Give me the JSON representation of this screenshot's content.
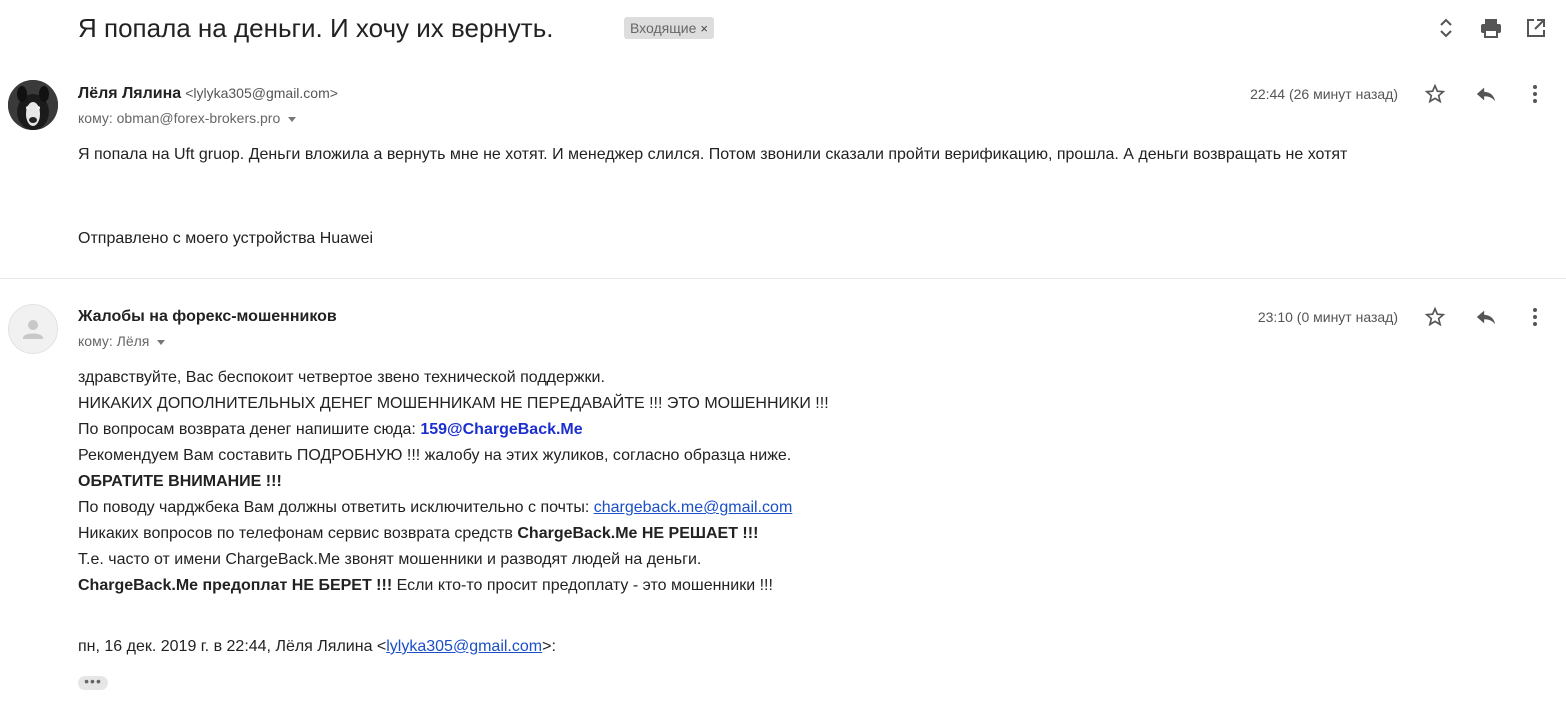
{
  "thread": {
    "subject": "Я попала на деньги. И хочу их вернуть.",
    "label": "Входящие",
    "label_remove": "×"
  },
  "icons": {
    "expand": "unfold-icon",
    "print": "print-icon",
    "new_window": "open-in-new-icon",
    "star": "star-icon",
    "reply": "reply-icon",
    "more": "more-vert-icon"
  },
  "messages": [
    {
      "sender_name": "Лёля Лялина",
      "sender_email": "<lylyka305@gmail.com>",
      "to": "кому: obman@forex-brokers.pro",
      "time": "22:44 (26 минут назад)",
      "body": [
        "Я попала на Uft gruop. Деньги вложила а вернуть мне не хотят. И менеджер слился. Потом звонили сказали пройти верификацию, прошла. А деньги возвращать не хотят",
        "Отправлено с моего устройства Huawei"
      ]
    },
    {
      "sender_name": "Жалобы на форекс-мошенников",
      "to": "кому: Лёля",
      "time": "23:10 (0 минут назад)",
      "lines": {
        "l1": "здравствуйте, Вас беспокоит четвертое звено технической поддержки.",
        "l2": "НИКАКИХ ДОПОЛНИТЕЛЬНЫХ ДЕНЕГ МОШЕННИКАМ НЕ ПЕРЕДАВАЙТЕ !!! ЭТО МОШЕННИКИ !!!",
        "l3_pre": "По вопросам возврата денег напишите сюда: ",
        "l3_email": "159@ChargeBack.Me",
        "l4": "Рекомендуем Вам составить ПОДРОБНУЮ !!! жалобу на этих жуликов, согласно образца ниже.",
        "l5": "ОБРАТИТЕ ВНИМАНИЕ !!!",
        "l6_pre": "По поводу чарджбека Вам должны ответить исключительно с почты: ",
        "l6_email": "chargeback.me@gmail.com",
        "l7_pre": "Никаких вопросов по телефонам сервис возврата средств ",
        "l7_bold": "ChargeBack.Me НЕ РЕШАЕТ !!!",
        "l8": "Т.е. часто от имени ChargeBack.Me звонят мошенники и разводят людей на деньги.",
        "l9_bold": "ChargeBack.Me предоплат НЕ БЕРЕТ !!!",
        "l9_post": " Если кто-то просит предоплату - это мошенники !!!",
        "quote_pre": "пн, 16 дек. 2019 г. в 22:44, Лёля Лялина <",
        "quote_email": "lylyka305@gmail.com",
        "quote_post": ">:",
        "trimmed": "•••"
      }
    }
  ]
}
